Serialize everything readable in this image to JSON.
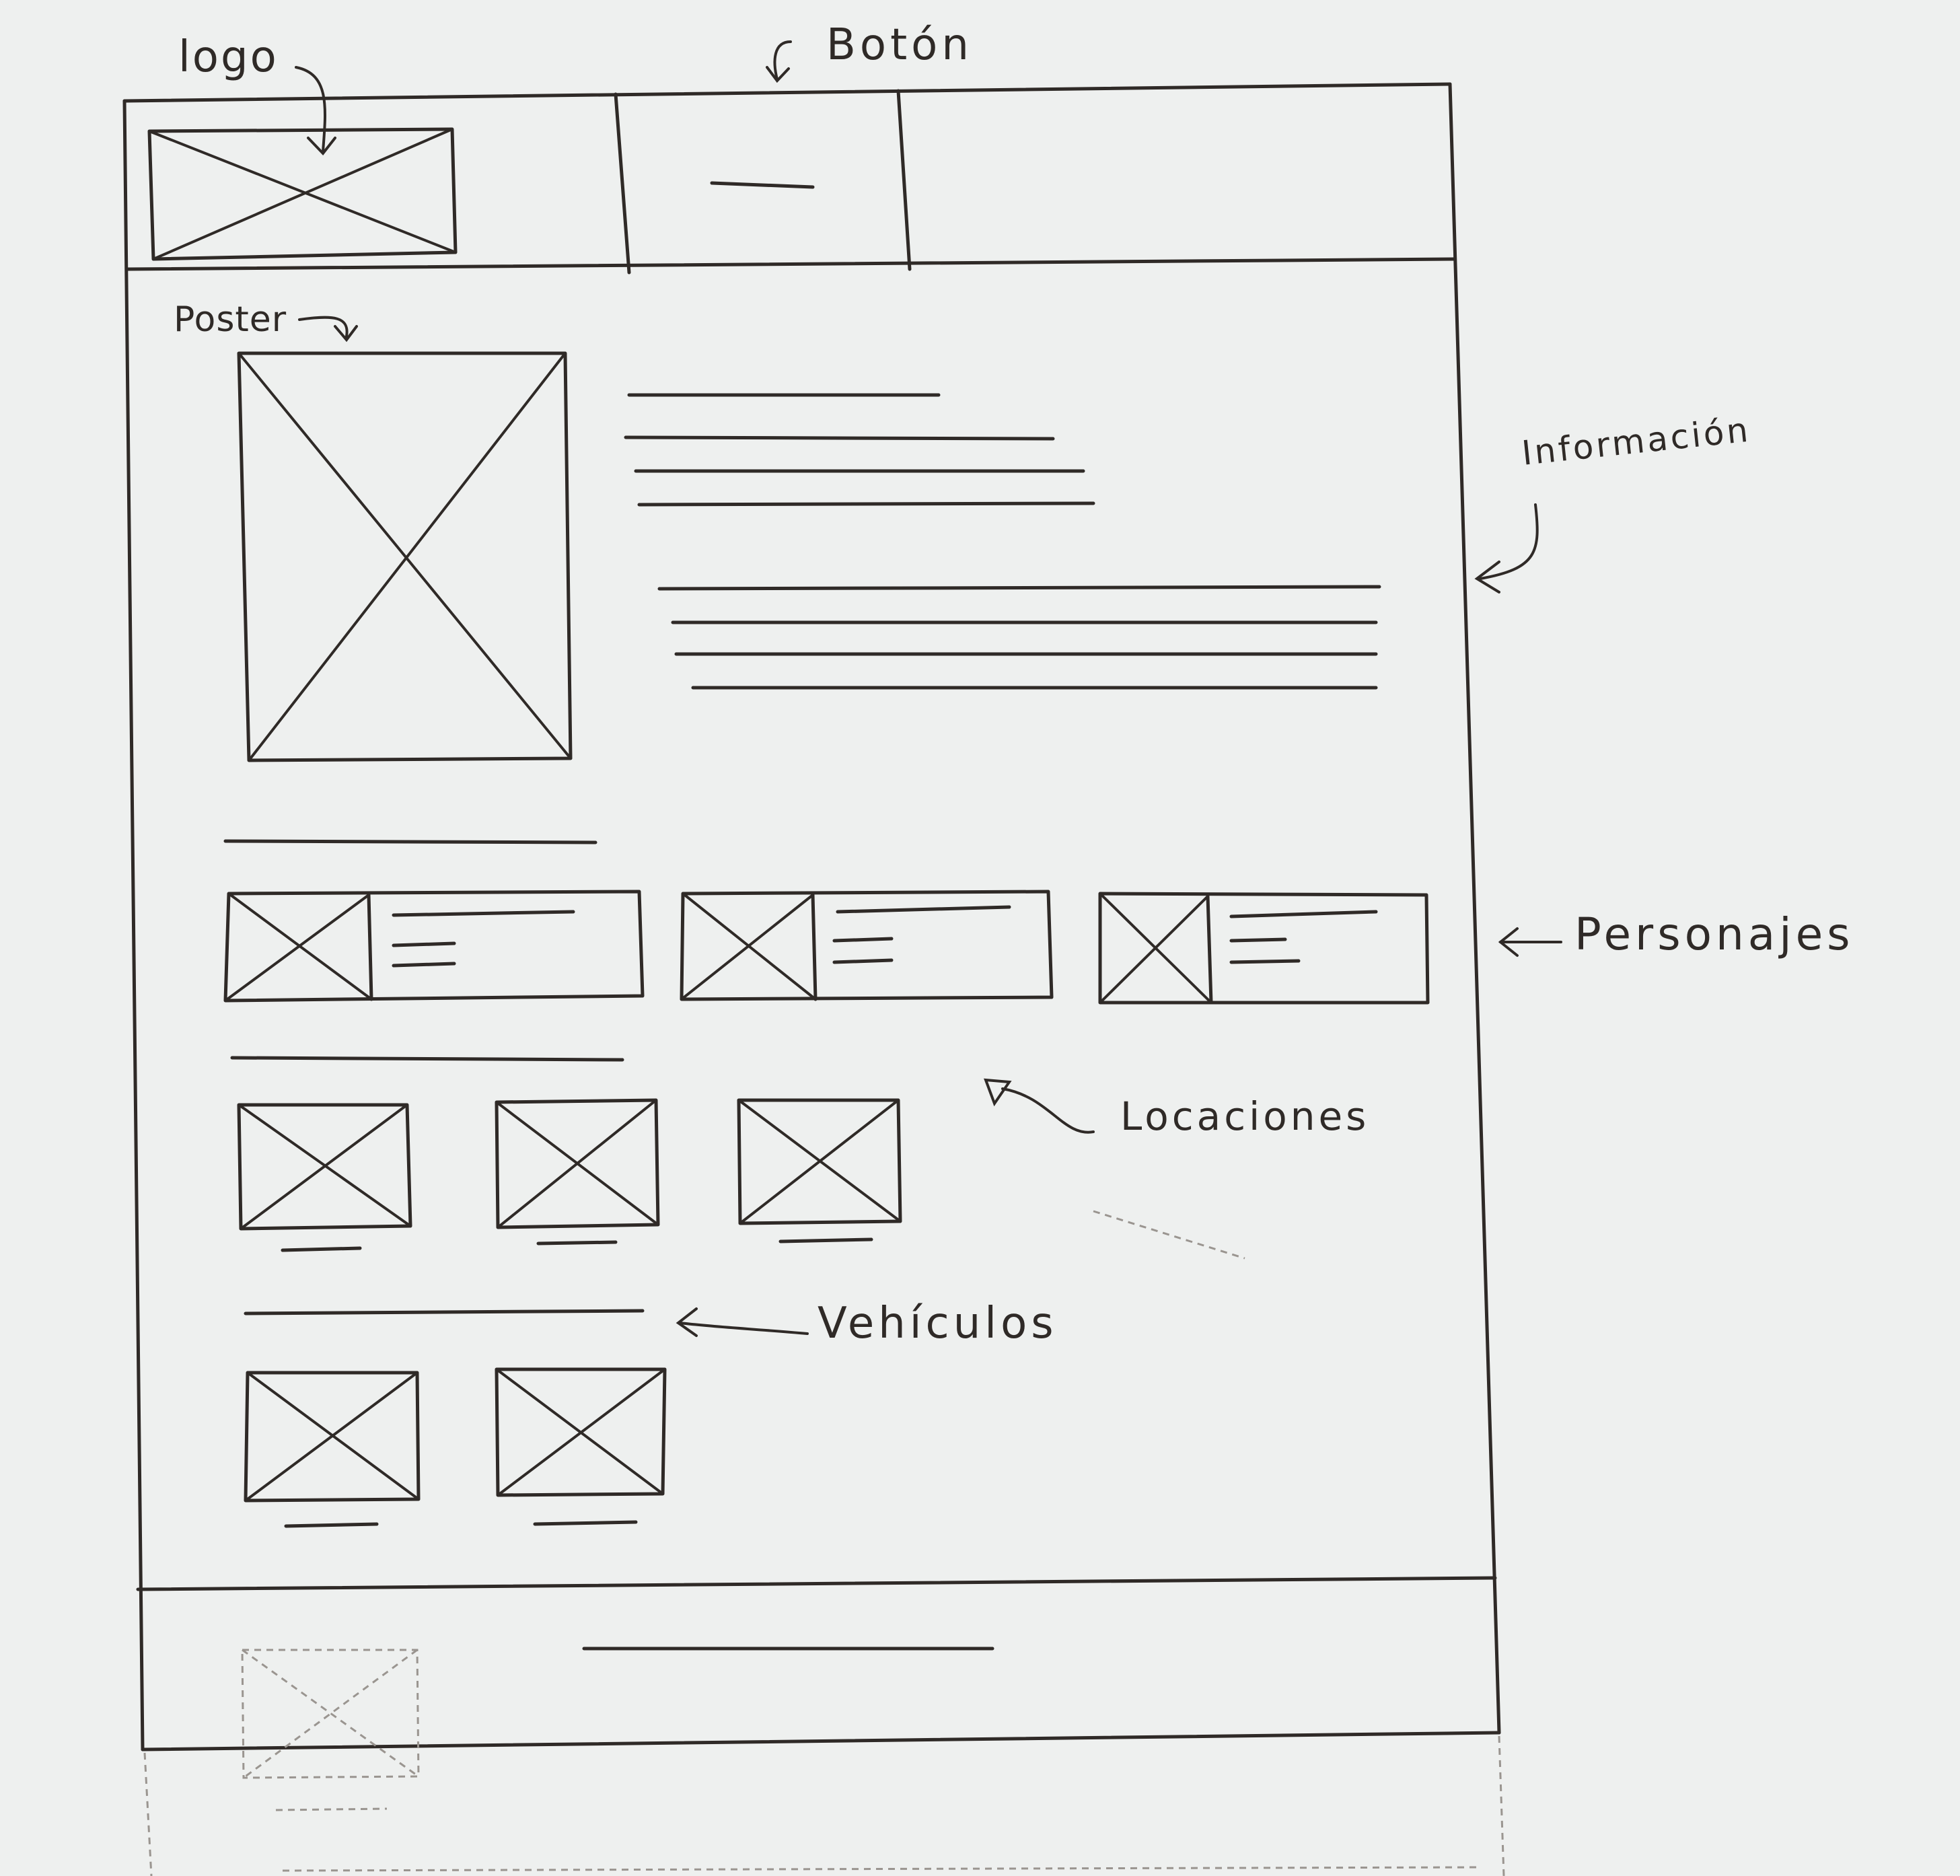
{
  "annotations": {
    "logo": "logo",
    "boton": "Botón",
    "poster": "Poster",
    "informacion": "Información",
    "personajes": "Personajes",
    "locaciones": "Locaciones",
    "vehiculos": "Vehículos"
  },
  "colors": {
    "paper": "#eef0ef",
    "ink": "#2f2a27"
  }
}
